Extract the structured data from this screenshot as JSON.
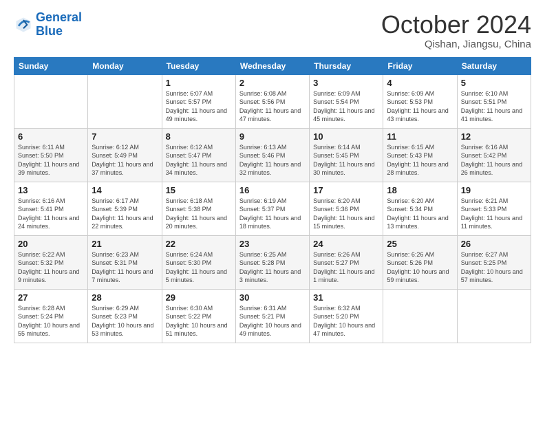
{
  "logo": {
    "line1": "General",
    "line2": "Blue"
  },
  "header": {
    "month": "October 2024",
    "location": "Qishan, Jiangsu, China"
  },
  "weekdays": [
    "Sunday",
    "Monday",
    "Tuesday",
    "Wednesday",
    "Thursday",
    "Friday",
    "Saturday"
  ],
  "weeks": [
    [
      {
        "day": "",
        "sunrise": "",
        "sunset": "",
        "daylight": ""
      },
      {
        "day": "",
        "sunrise": "",
        "sunset": "",
        "daylight": ""
      },
      {
        "day": "1",
        "sunrise": "Sunrise: 6:07 AM",
        "sunset": "Sunset: 5:57 PM",
        "daylight": "Daylight: 11 hours and 49 minutes."
      },
      {
        "day": "2",
        "sunrise": "Sunrise: 6:08 AM",
        "sunset": "Sunset: 5:56 PM",
        "daylight": "Daylight: 11 hours and 47 minutes."
      },
      {
        "day": "3",
        "sunrise": "Sunrise: 6:09 AM",
        "sunset": "Sunset: 5:54 PM",
        "daylight": "Daylight: 11 hours and 45 minutes."
      },
      {
        "day": "4",
        "sunrise": "Sunrise: 6:09 AM",
        "sunset": "Sunset: 5:53 PM",
        "daylight": "Daylight: 11 hours and 43 minutes."
      },
      {
        "day": "5",
        "sunrise": "Sunrise: 6:10 AM",
        "sunset": "Sunset: 5:51 PM",
        "daylight": "Daylight: 11 hours and 41 minutes."
      }
    ],
    [
      {
        "day": "6",
        "sunrise": "Sunrise: 6:11 AM",
        "sunset": "Sunset: 5:50 PM",
        "daylight": "Daylight: 11 hours and 39 minutes."
      },
      {
        "day": "7",
        "sunrise": "Sunrise: 6:12 AM",
        "sunset": "Sunset: 5:49 PM",
        "daylight": "Daylight: 11 hours and 37 minutes."
      },
      {
        "day": "8",
        "sunrise": "Sunrise: 6:12 AM",
        "sunset": "Sunset: 5:47 PM",
        "daylight": "Daylight: 11 hours and 34 minutes."
      },
      {
        "day": "9",
        "sunrise": "Sunrise: 6:13 AM",
        "sunset": "Sunset: 5:46 PM",
        "daylight": "Daylight: 11 hours and 32 minutes."
      },
      {
        "day": "10",
        "sunrise": "Sunrise: 6:14 AM",
        "sunset": "Sunset: 5:45 PM",
        "daylight": "Daylight: 11 hours and 30 minutes."
      },
      {
        "day": "11",
        "sunrise": "Sunrise: 6:15 AM",
        "sunset": "Sunset: 5:43 PM",
        "daylight": "Daylight: 11 hours and 28 minutes."
      },
      {
        "day": "12",
        "sunrise": "Sunrise: 6:16 AM",
        "sunset": "Sunset: 5:42 PM",
        "daylight": "Daylight: 11 hours and 26 minutes."
      }
    ],
    [
      {
        "day": "13",
        "sunrise": "Sunrise: 6:16 AM",
        "sunset": "Sunset: 5:41 PM",
        "daylight": "Daylight: 11 hours and 24 minutes."
      },
      {
        "day": "14",
        "sunrise": "Sunrise: 6:17 AM",
        "sunset": "Sunset: 5:39 PM",
        "daylight": "Daylight: 11 hours and 22 minutes."
      },
      {
        "day": "15",
        "sunrise": "Sunrise: 6:18 AM",
        "sunset": "Sunset: 5:38 PM",
        "daylight": "Daylight: 11 hours and 20 minutes."
      },
      {
        "day": "16",
        "sunrise": "Sunrise: 6:19 AM",
        "sunset": "Sunset: 5:37 PM",
        "daylight": "Daylight: 11 hours and 18 minutes."
      },
      {
        "day": "17",
        "sunrise": "Sunrise: 6:20 AM",
        "sunset": "Sunset: 5:36 PM",
        "daylight": "Daylight: 11 hours and 15 minutes."
      },
      {
        "day": "18",
        "sunrise": "Sunrise: 6:20 AM",
        "sunset": "Sunset: 5:34 PM",
        "daylight": "Daylight: 11 hours and 13 minutes."
      },
      {
        "day": "19",
        "sunrise": "Sunrise: 6:21 AM",
        "sunset": "Sunset: 5:33 PM",
        "daylight": "Daylight: 11 hours and 11 minutes."
      }
    ],
    [
      {
        "day": "20",
        "sunrise": "Sunrise: 6:22 AM",
        "sunset": "Sunset: 5:32 PM",
        "daylight": "Daylight: 11 hours and 9 minutes."
      },
      {
        "day": "21",
        "sunrise": "Sunrise: 6:23 AM",
        "sunset": "Sunset: 5:31 PM",
        "daylight": "Daylight: 11 hours and 7 minutes."
      },
      {
        "day": "22",
        "sunrise": "Sunrise: 6:24 AM",
        "sunset": "Sunset: 5:30 PM",
        "daylight": "Daylight: 11 hours and 5 minutes."
      },
      {
        "day": "23",
        "sunrise": "Sunrise: 6:25 AM",
        "sunset": "Sunset: 5:28 PM",
        "daylight": "Daylight: 11 hours and 3 minutes."
      },
      {
        "day": "24",
        "sunrise": "Sunrise: 6:26 AM",
        "sunset": "Sunset: 5:27 PM",
        "daylight": "Daylight: 11 hours and 1 minute."
      },
      {
        "day": "25",
        "sunrise": "Sunrise: 6:26 AM",
        "sunset": "Sunset: 5:26 PM",
        "daylight": "Daylight: 10 hours and 59 minutes."
      },
      {
        "day": "26",
        "sunrise": "Sunrise: 6:27 AM",
        "sunset": "Sunset: 5:25 PM",
        "daylight": "Daylight: 10 hours and 57 minutes."
      }
    ],
    [
      {
        "day": "27",
        "sunrise": "Sunrise: 6:28 AM",
        "sunset": "Sunset: 5:24 PM",
        "daylight": "Daylight: 10 hours and 55 minutes."
      },
      {
        "day": "28",
        "sunrise": "Sunrise: 6:29 AM",
        "sunset": "Sunset: 5:23 PM",
        "daylight": "Daylight: 10 hours and 53 minutes."
      },
      {
        "day": "29",
        "sunrise": "Sunrise: 6:30 AM",
        "sunset": "Sunset: 5:22 PM",
        "daylight": "Daylight: 10 hours and 51 minutes."
      },
      {
        "day": "30",
        "sunrise": "Sunrise: 6:31 AM",
        "sunset": "Sunset: 5:21 PM",
        "daylight": "Daylight: 10 hours and 49 minutes."
      },
      {
        "day": "31",
        "sunrise": "Sunrise: 6:32 AM",
        "sunset": "Sunset: 5:20 PM",
        "daylight": "Daylight: 10 hours and 47 minutes."
      },
      {
        "day": "",
        "sunrise": "",
        "sunset": "",
        "daylight": ""
      },
      {
        "day": "",
        "sunrise": "",
        "sunset": "",
        "daylight": ""
      }
    ]
  ]
}
